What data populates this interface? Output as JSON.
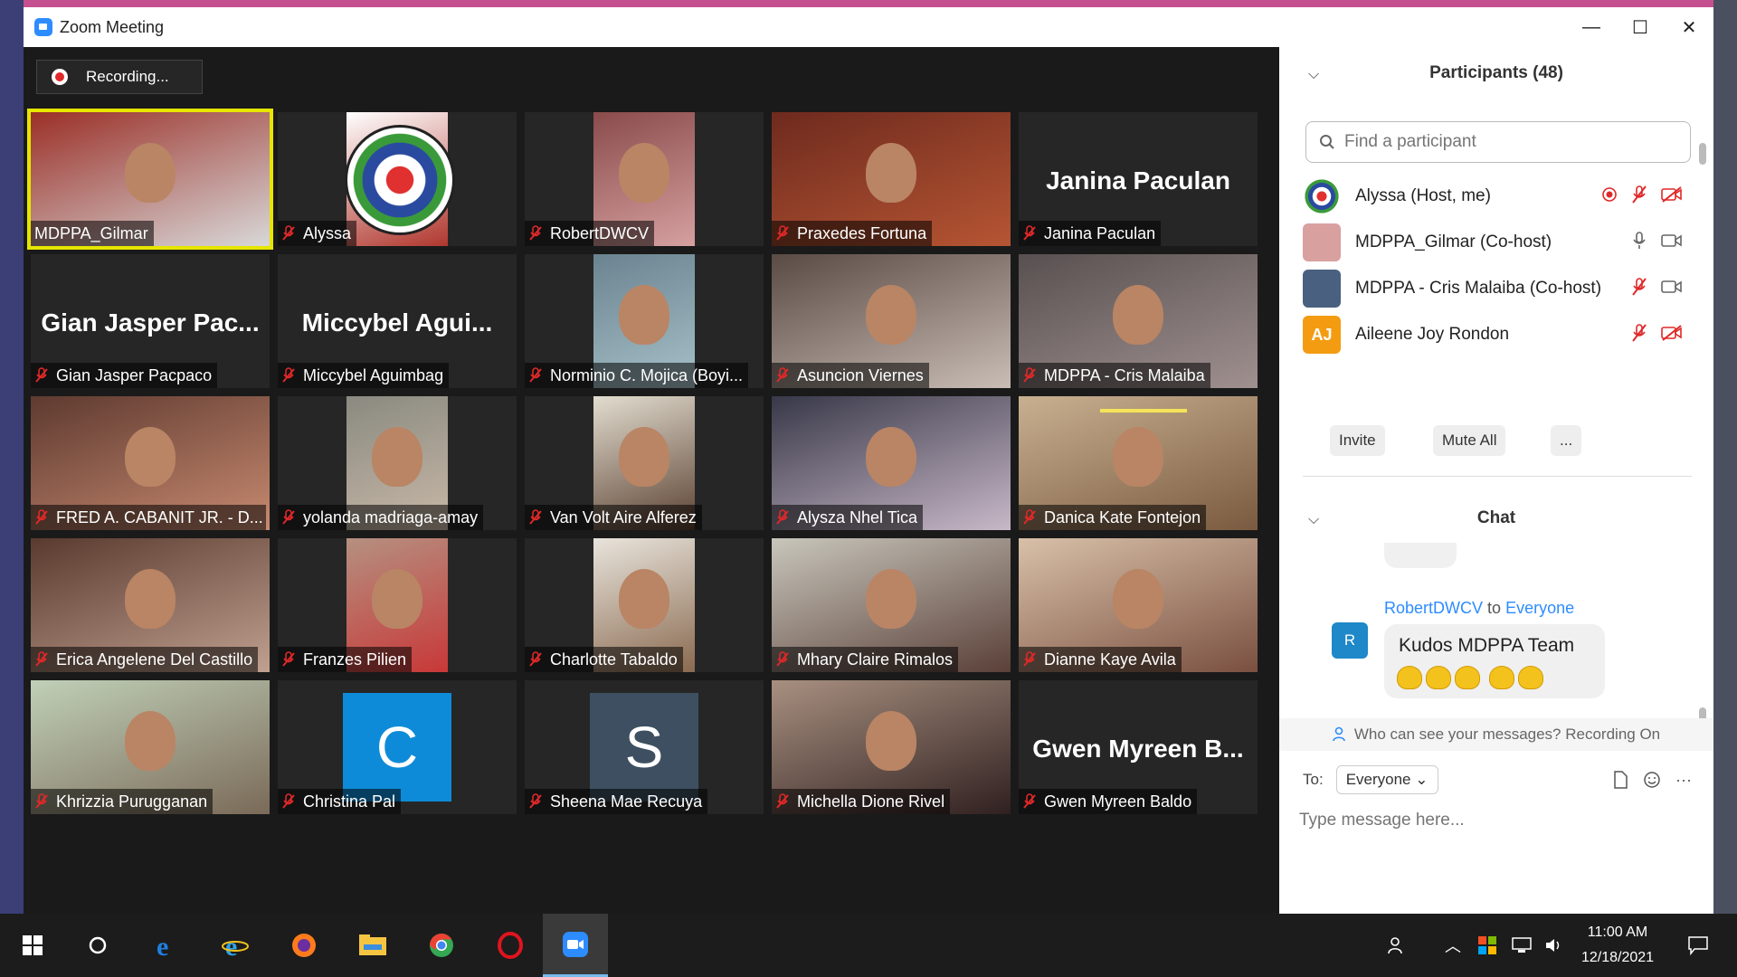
{
  "window": {
    "title": "Zoom Meeting",
    "minimize_glyph": "—",
    "maximize_glyph": "☐",
    "close_glyph": "✕"
  },
  "recording": {
    "label": "Recording..."
  },
  "tiles": [
    {
      "name": "MDPPA_Gilmar",
      "muted": false,
      "active": true,
      "kind": "video",
      "bg": "#9b2f27",
      "accent": "#d8d8d8"
    },
    {
      "name": "Alyssa",
      "muted": true,
      "kind": "logo",
      "bg": "#ffffff",
      "accent": "#b0372e"
    },
    {
      "name": "RobertDWCV",
      "muted": true,
      "kind": "video",
      "bg": "#8a4b4b",
      "accent": "#d6a0a0"
    },
    {
      "name": "Praxedes Fortuna",
      "muted": true,
      "kind": "video",
      "bg": "#6e2a1e",
      "accent": "#b65533"
    },
    {
      "name": "Janina Paculan",
      "muted": true,
      "kind": "text",
      "big": "Janina Paculan"
    },
    {
      "name": "Gian Jasper Pacpaco",
      "muted": true,
      "kind": "text",
      "big": "Gian Jasper Pac..."
    },
    {
      "name": "Miccybel Aguimbag",
      "muted": true,
      "kind": "text",
      "big": "Miccybel Agui..."
    },
    {
      "name": "Norminio C. Mojica (Boyi...",
      "muted": true,
      "kind": "video",
      "bg": "#6a8390",
      "accent": "#a7c1c9"
    },
    {
      "name": "Asuncion Viernes",
      "muted": true,
      "kind": "video",
      "bg": "#5a4a44",
      "accent": "#c9bdb5"
    },
    {
      "name": "MDPPA - Cris Malaiba",
      "muted": true,
      "kind": "video",
      "bg": "#585050",
      "accent": "#a09090"
    },
    {
      "name": "FRED A. CABANIT JR. - D...",
      "muted": true,
      "kind": "video",
      "bg": "#5e3a30",
      "accent": "#c88a70"
    },
    {
      "name": "yolanda madriaga-amay",
      "muted": true,
      "kind": "video",
      "bg": "#8a8a80",
      "accent": "#c8b8a8"
    },
    {
      "name": "Van Volt Aire Alferez",
      "muted": true,
      "kind": "video",
      "bg": "#e2ddd0",
      "accent": "#5a4030"
    },
    {
      "name": "Alysza Nhel Tica",
      "muted": true,
      "kind": "video",
      "bg": "#383848",
      "accent": "#c8b8c8"
    },
    {
      "name": "Danica Kate Fontejon",
      "muted": true,
      "kind": "video",
      "bg": "#c8b090",
      "accent": "#7a5a40"
    },
    {
      "name": "Erica Angelene Del Castillo",
      "muted": true,
      "kind": "video",
      "bg": "#5a3a2e",
      "accent": "#c0a090"
    },
    {
      "name": "Franzes Pilien",
      "muted": true,
      "kind": "video",
      "bg": "#b59080",
      "accent": "#c83838"
    },
    {
      "name": "Charlotte Tabaldo",
      "muted": true,
      "kind": "video",
      "bg": "#e8e4dc",
      "accent": "#8a6a50"
    },
    {
      "name": "Mhary Claire Rimalos",
      "muted": true,
      "kind": "video",
      "bg": "#c8c6bc",
      "accent": "#5a4038"
    },
    {
      "name": "Dianne Kaye Avila",
      "muted": true,
      "kind": "video",
      "bg": "#d8c0a8",
      "accent": "#7a5040"
    },
    {
      "name": "Khrizzia Purugganan",
      "muted": true,
      "kind": "video",
      "bg": "#c0d0b8",
      "accent": "#7a6a58"
    },
    {
      "name": "Christina Pal",
      "muted": true,
      "kind": "letter",
      "letter": "C",
      "bg": "#0e8bd8"
    },
    {
      "name": "Sheena Mae Recuya",
      "muted": true,
      "kind": "letter",
      "letter": "S",
      "bg": "#3d4f60"
    },
    {
      "name": "Michella Dione Rivel",
      "muted": true,
      "kind": "video",
      "bg": "#a89080",
      "accent": "#302020"
    },
    {
      "name": "Gwen Myreen Baldo",
      "muted": true,
      "kind": "text",
      "big": "Gwen Myreen B..."
    }
  ],
  "participants": {
    "header": "Participants (48)",
    "search_placeholder": "Find a participant",
    "rows": [
      {
        "name": "Alyssa (Host, me)",
        "avatar_bg": "#ffffff",
        "avatar_text": "",
        "icons": [
          "recording-indicator",
          "mic-off",
          "video-off"
        ]
      },
      {
        "name": "MDPPA_Gilmar (Co-host)",
        "avatar_bg": "#d9a0a0",
        "avatar_text": "",
        "icons": [
          "mic-on",
          "video-on"
        ]
      },
      {
        "name": "MDPPA - Cris Malaiba (Co-host)",
        "avatar_bg": "#4a6080",
        "avatar_text": "",
        "icons": [
          "mic-off",
          "video-on"
        ]
      },
      {
        "name": "Aileene Joy Rondon",
        "avatar_bg": "#f39c12",
        "avatar_text": "AJ",
        "icons": [
          "mic-off",
          "video-off"
        ]
      }
    ],
    "buttons": {
      "invite": "Invite",
      "mute_all": "Mute All",
      "more": "..."
    }
  },
  "chat": {
    "header": "Chat",
    "sender": "RobertDWCV",
    "to_word": "to",
    "recipient": "Everyone",
    "sender_initial": "R",
    "message": "Kudos MDPPA  Team",
    "clap_count": 5,
    "who_can_see": "Who can see your messages? Recording On",
    "to_label": "To:",
    "to_value": "Everyone",
    "input_placeholder": "Type message here...",
    "more_glyph": "···"
  },
  "taskbar": {
    "time": "11:00 AM",
    "date": "12/18/2021",
    "apps": [
      "start-icon",
      "search-icon",
      "edge-icon",
      "ie-icon",
      "firefox-icon",
      "file-explorer-icon",
      "chrome-icon",
      "opera-icon",
      "zoom-icon"
    ]
  },
  "colors": {
    "accent": "#2d8cff",
    "active_speaker": "#e6e600",
    "mic_off": "#e02828"
  }
}
